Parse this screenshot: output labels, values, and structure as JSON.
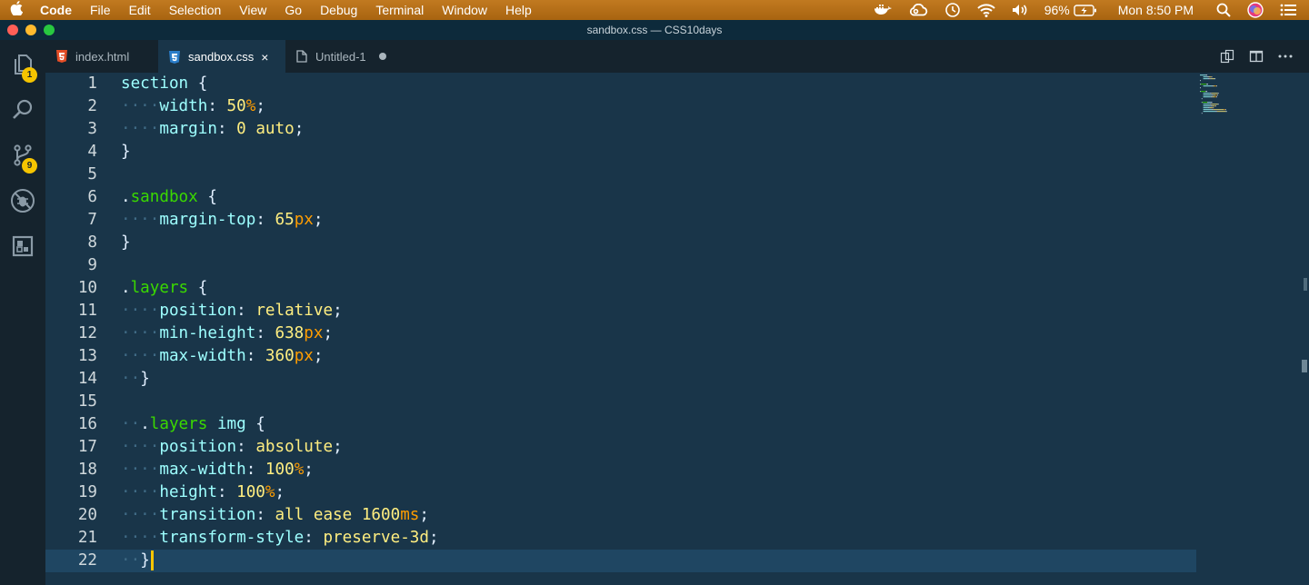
{
  "menubar": {
    "app": "Code",
    "items": [
      "File",
      "Edit",
      "Selection",
      "View",
      "Go",
      "Debug",
      "Terminal",
      "Window",
      "Help"
    ],
    "battery": "96%",
    "clock": "Mon 8:50 PM"
  },
  "window": {
    "title": "sandbox.css — CSS10days"
  },
  "activity": {
    "explorer_badge": "1",
    "scm_badge": "9"
  },
  "tabs": [
    {
      "label": "index.html",
      "icon": "html5-icon"
    },
    {
      "label": "sandbox.css",
      "icon": "css3-icon",
      "close": "×"
    },
    {
      "label": "Untitled-1",
      "icon": "file-icon"
    }
  ],
  "colors": {
    "editor_bg": "#193549",
    "selector": "#9effff",
    "class": "#3ad900",
    "value": "#ffee80",
    "unit": "#ff9d00",
    "cursor": "#ffc600",
    "badge": "#f5c400"
  },
  "editor": {
    "current_line": 22,
    "lines": [
      {
        "n": "1",
        "tokens": [
          [
            "sel",
            "section"
          ],
          [
            "punc",
            " {"
          ]
        ]
      },
      {
        "n": "2",
        "tokens": [
          [
            "ws",
            "····"
          ],
          [
            "prop",
            "width"
          ],
          [
            "punc",
            ": "
          ],
          [
            "numv",
            "50"
          ],
          [
            "unit",
            "%"
          ],
          [
            "punc",
            ";"
          ]
        ]
      },
      {
        "n": "3",
        "tokens": [
          [
            "ws",
            "····"
          ],
          [
            "prop",
            "margin"
          ],
          [
            "punc",
            ": "
          ],
          [
            "numv",
            "0"
          ],
          [
            "punc",
            " "
          ],
          [
            "val",
            "auto"
          ],
          [
            "punc",
            ";"
          ]
        ]
      },
      {
        "n": "4",
        "tokens": [
          [
            "brace",
            "}"
          ]
        ]
      },
      {
        "n": "5",
        "tokens": []
      },
      {
        "n": "6",
        "tokens": [
          [
            "dot",
            "."
          ],
          [
            "cls",
            "sandbox"
          ],
          [
            "punc",
            " {"
          ]
        ]
      },
      {
        "n": "7",
        "tokens": [
          [
            "ws",
            "····"
          ],
          [
            "prop",
            "margin-top"
          ],
          [
            "punc",
            ": "
          ],
          [
            "numv",
            "65"
          ],
          [
            "unit",
            "px"
          ],
          [
            "punc",
            ";"
          ]
        ]
      },
      {
        "n": "8",
        "tokens": [
          [
            "brace",
            "}"
          ]
        ]
      },
      {
        "n": "9",
        "tokens": []
      },
      {
        "n": "10",
        "tokens": [
          [
            "dot",
            "."
          ],
          [
            "cls",
            "layers"
          ],
          [
            "punc",
            " {"
          ]
        ]
      },
      {
        "n": "11",
        "tokens": [
          [
            "ws",
            "····"
          ],
          [
            "prop",
            "position"
          ],
          [
            "punc",
            ": "
          ],
          [
            "val",
            "relative"
          ],
          [
            "punc",
            ";"
          ]
        ]
      },
      {
        "n": "12",
        "tokens": [
          [
            "ws",
            "····"
          ],
          [
            "prop",
            "min-height"
          ],
          [
            "punc",
            ": "
          ],
          [
            "numv",
            "638"
          ],
          [
            "unit",
            "px"
          ],
          [
            "punc",
            ";"
          ]
        ]
      },
      {
        "n": "13",
        "tokens": [
          [
            "ws",
            "····"
          ],
          [
            "prop",
            "max-width"
          ],
          [
            "punc",
            ": "
          ],
          [
            "numv",
            "360"
          ],
          [
            "unit",
            "px"
          ],
          [
            "punc",
            ";"
          ]
        ]
      },
      {
        "n": "14",
        "tokens": [
          [
            "ws",
            "··"
          ],
          [
            "brace",
            "}"
          ]
        ]
      },
      {
        "n": "15",
        "tokens": []
      },
      {
        "n": "16",
        "tokens": [
          [
            "ws",
            "··"
          ],
          [
            "dot",
            "."
          ],
          [
            "cls",
            "layers"
          ],
          [
            "punc",
            " "
          ],
          [
            "sel",
            "img"
          ],
          [
            "punc",
            " {"
          ]
        ]
      },
      {
        "n": "17",
        "tokens": [
          [
            "ws",
            "····"
          ],
          [
            "prop",
            "position"
          ],
          [
            "punc",
            ": "
          ],
          [
            "val",
            "absolute"
          ],
          [
            "punc",
            ";"
          ]
        ]
      },
      {
        "n": "18",
        "tokens": [
          [
            "ws",
            "····"
          ],
          [
            "prop",
            "max-width"
          ],
          [
            "punc",
            ": "
          ],
          [
            "numv",
            "100"
          ],
          [
            "unit",
            "%"
          ],
          [
            "punc",
            ";"
          ]
        ]
      },
      {
        "n": "19",
        "tokens": [
          [
            "ws",
            "····"
          ],
          [
            "prop",
            "height"
          ],
          [
            "punc",
            ": "
          ],
          [
            "numv",
            "100"
          ],
          [
            "unit",
            "%"
          ],
          [
            "punc",
            ";"
          ]
        ]
      },
      {
        "n": "20",
        "tokens": [
          [
            "ws",
            "····"
          ],
          [
            "prop",
            "transition"
          ],
          [
            "punc",
            ": "
          ],
          [
            "val",
            "all ease "
          ],
          [
            "numv",
            "1600"
          ],
          [
            "unit",
            "ms"
          ],
          [
            "punc",
            ";"
          ]
        ]
      },
      {
        "n": "21",
        "tokens": [
          [
            "ws",
            "····"
          ],
          [
            "prop",
            "transform-style"
          ],
          [
            "punc",
            ": "
          ],
          [
            "val",
            "preserve-3d"
          ],
          [
            "punc",
            ";"
          ]
        ]
      },
      {
        "n": "22",
        "tokens": [
          [
            "ws",
            "··"
          ],
          [
            "brace",
            "}"
          ]
        ]
      }
    ]
  }
}
